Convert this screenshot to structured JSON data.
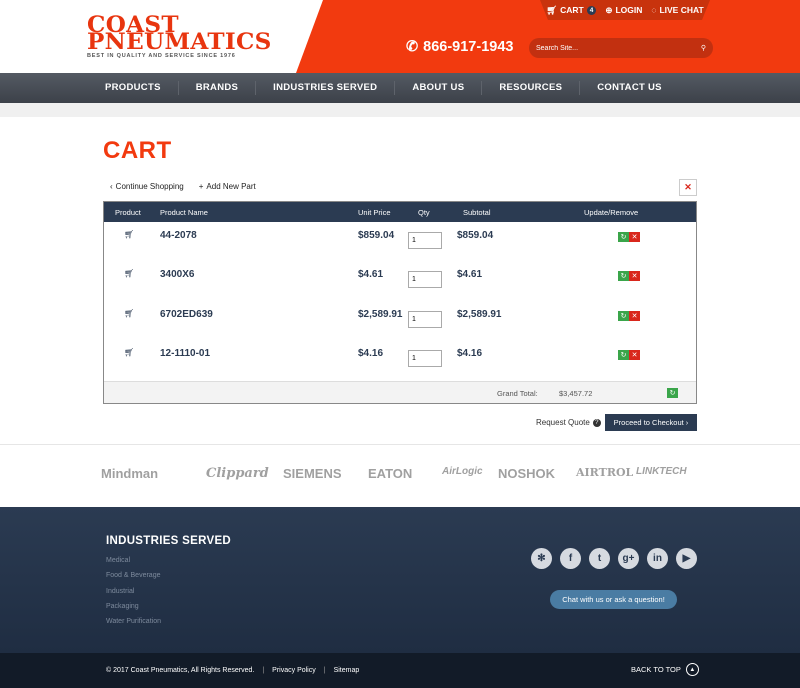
{
  "header": {
    "logo_line1": "COAST",
    "logo_line2": "PNEUMATICS",
    "tagline": "BEST IN QUALITY AND SERVICE SINCE 1976",
    "cart_label": "CART",
    "cart_count": "4",
    "login_label": "LOGIN",
    "livechat_label": "LIVE CHAT",
    "phone": "866-917-1943",
    "search_placeholder": "Search Site..."
  },
  "nav": [
    "PRODUCTS",
    "BRANDS",
    "INDUSTRIES SERVED",
    "ABOUT US",
    "RESOURCES",
    "CONTACT US"
  ],
  "cart": {
    "title": "CART",
    "continue_shopping": "Continue Shopping",
    "add_new_part": "Add New Part",
    "columns": [
      "Product",
      "Product Name",
      "Unit Price",
      "Qty",
      "Subtotal",
      "Update/Remove"
    ],
    "rows": [
      {
        "name": "44-2078",
        "unit_price": "$859.04",
        "qty": "1",
        "subtotal": "$859.04"
      },
      {
        "name": "3400X6",
        "unit_price": "$4.61",
        "qty": "1",
        "subtotal": "$4.61"
      },
      {
        "name": "6702ED639",
        "unit_price": "$2,589.91",
        "qty": "1",
        "subtotal": "$2,589.91"
      },
      {
        "name": "12-1110-01",
        "unit_price": "$4.16",
        "qty": "1",
        "subtotal": "$4.16"
      }
    ],
    "grand_total_label": "Grand Total:",
    "grand_total": "$3,457.72",
    "request_quote": "Request Quote",
    "checkout": "Proceed to Checkout"
  },
  "brands": [
    "Mindman",
    "Clippard",
    "SIEMENS",
    "EATON",
    "AirLogic",
    "NOSHOK",
    "AIRTROL",
    "LINKTECH"
  ],
  "footer": {
    "title": "INDUSTRIES SERVED",
    "items": [
      "Medical",
      "Food & Beverage",
      "Industrial",
      "Packaging",
      "Water Purification"
    ],
    "chat": "Chat with us or ask a question!",
    "copyright": "© 2017 Coast Pneumatics, All Rights Reserved.",
    "privacy": "Privacy Policy",
    "sitemap": "Sitemap",
    "back_to_top": "BACK TO TOP"
  },
  "colors": {
    "accent": "#f23a0f",
    "navy": "#2b3b52"
  }
}
